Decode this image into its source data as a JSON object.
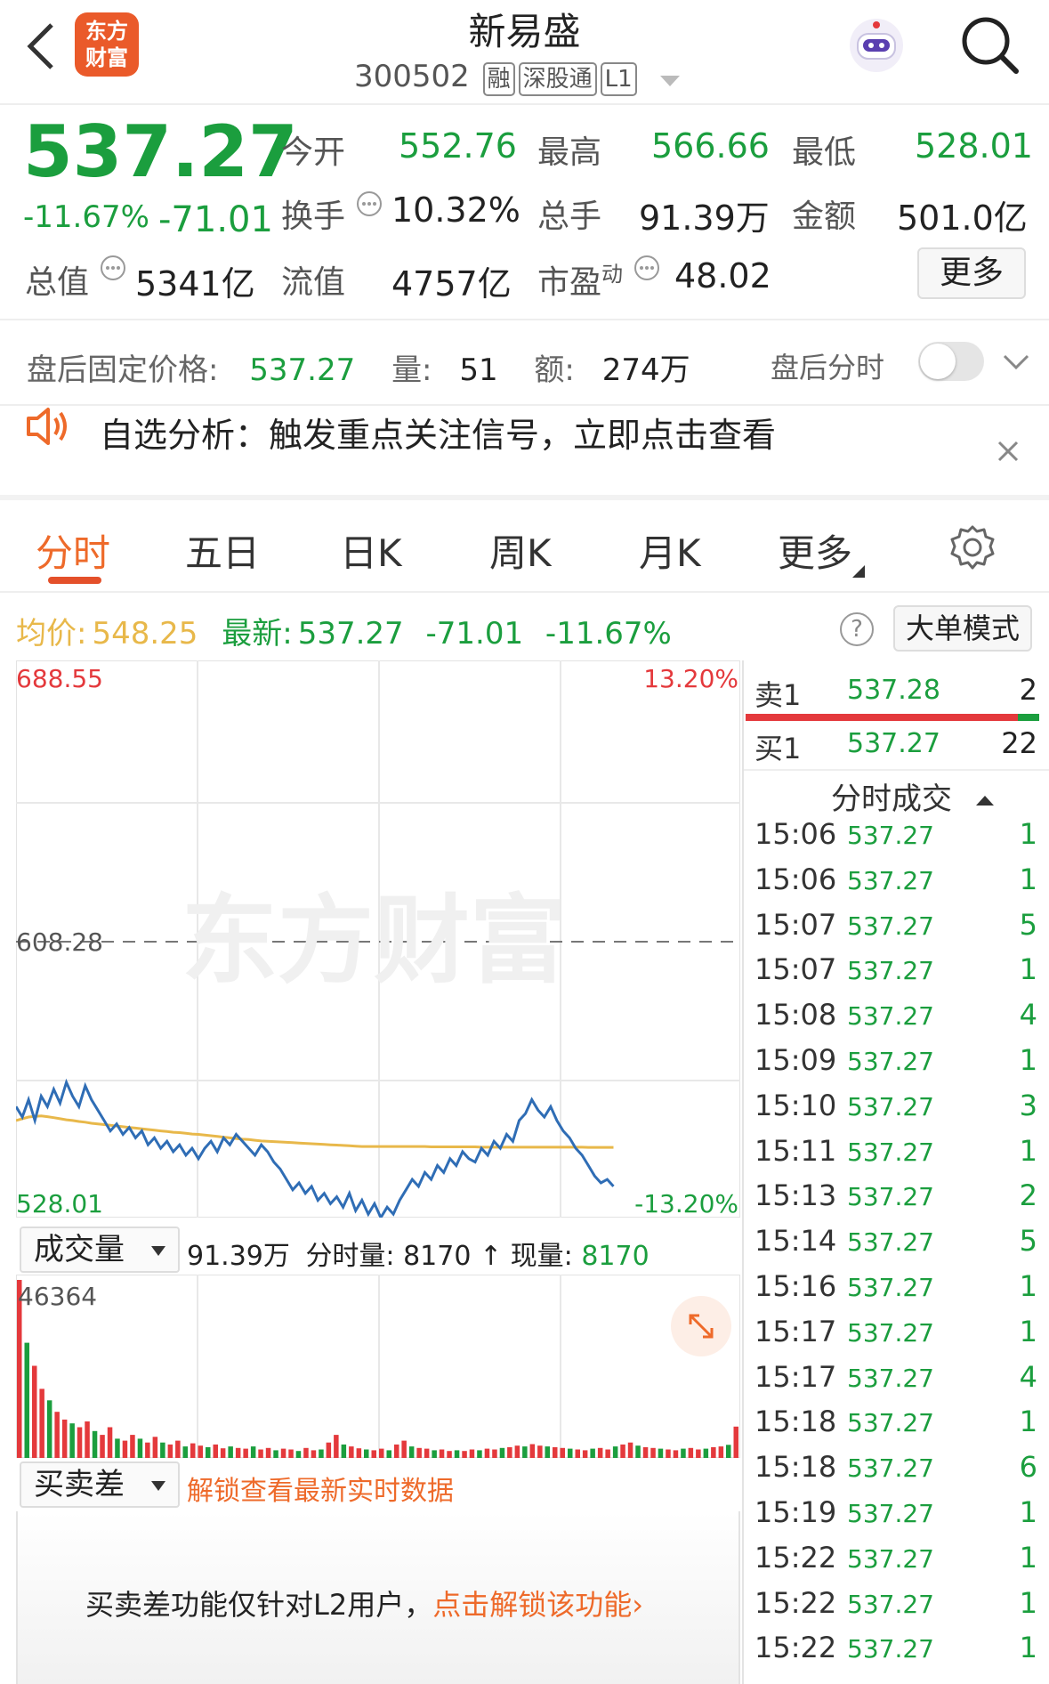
{
  "header": {
    "logo_text_1": "东方",
    "logo_text_2": "财富",
    "stock_name": "新易盛",
    "stock_code": "300502",
    "tags": [
      "融",
      "深股通",
      "L1"
    ]
  },
  "quote": {
    "price": "537.27",
    "change_pct": "-11.67%",
    "change_amt": "-71.01",
    "open_label": "今开",
    "open_value": "552.76",
    "high_label": "最高",
    "high_value": "566.66",
    "low_label": "最低",
    "low_value": "528.01",
    "turnover_label": "换手",
    "turnover_value": "10.32%",
    "volume_label": "总手",
    "volume_value": "91.39万",
    "amount_label": "金额",
    "amount_value": "501.0亿",
    "mktcap_label": "总值",
    "mktcap_value": "5341亿",
    "float_label": "流值",
    "float_value": "4757亿",
    "pe_label": "市盈",
    "pe_sup": "动",
    "pe_value": "48.02",
    "more_button": "更多"
  },
  "after_hours": {
    "label": "盘后固定价格:",
    "price": "537.27",
    "vol_label": "量:",
    "vol": "51",
    "amt_label": "额:",
    "amt": "274万",
    "toggle_label": "盘后分时"
  },
  "notice": {
    "text": "自选分析：触发重点关注信号，立即点击查看"
  },
  "tabs": [
    "分时",
    "五日",
    "日K",
    "周K",
    "月K",
    "更多"
  ],
  "info_bar": {
    "avg_label": "均价:",
    "avg_value": "548.25",
    "latest_label": "最新:",
    "latest_value": "537.27",
    "latest_change": "-71.01",
    "latest_pct": "-11.67%",
    "help": "?",
    "big_order_button": "大单模式"
  },
  "chart_data": {
    "type": "line",
    "y_top": "688.55",
    "y_mid": "608.28",
    "y_bottom": "528.01",
    "pct_top": "13.20%",
    "pct_bottom": "-13.20%",
    "ylim": [
      528.01,
      688.55
    ],
    "watermark": "东方财富",
    "series": [
      {
        "name": "价格",
        "values": [
          560,
          557,
          562,
          556,
          563,
          560,
          565,
          561,
          567,
          563,
          560,
          566,
          562,
          559,
          556,
          553,
          555,
          552,
          554,
          551,
          553,
          549,
          551,
          548,
          550,
          547,
          549,
          546,
          548,
          545,
          548,
          550,
          547,
          551,
          549,
          552,
          550,
          548,
          546,
          549,
          547,
          544,
          542,
          539,
          536,
          538,
          535,
          537,
          533,
          535,
          532,
          534,
          531,
          535,
          530,
          533,
          529,
          532,
          528,
          531,
          529,
          533,
          536,
          539,
          537,
          541,
          539,
          543,
          541,
          545,
          543,
          547,
          545,
          544,
          548,
          546,
          550,
          548,
          552,
          550,
          556,
          558,
          562,
          559,
          557,
          560,
          556,
          553,
          551,
          548,
          546,
          543,
          540,
          538,
          539,
          537
        ]
      },
      {
        "name": "均价",
        "values": [
          556,
          556.5,
          557,
          557.2,
          557.3,
          557.1,
          556.8,
          556.5,
          556.2,
          556,
          555.7,
          555.5,
          555.2,
          555,
          554.8,
          554.6,
          554.4,
          554.2,
          554,
          553.8,
          553.6,
          553.4,
          553.2,
          553,
          552.8,
          552.6,
          552.5,
          552.3,
          552.1,
          552,
          551.8,
          551.6,
          551.4,
          551.2,
          551,
          550.8,
          550.6,
          550.5,
          550.3,
          550.1,
          550,
          549.9,
          549.8,
          549.7,
          549.6,
          549.5,
          549.4,
          549.3,
          549.2,
          549.1,
          549,
          548.9,
          548.8,
          548.7,
          548.6,
          548.5,
          548.5,
          548.5,
          548.5,
          548.5,
          548.5,
          548.5,
          548.5,
          548.5,
          548.5,
          548.5,
          548.4,
          548.4,
          548.4,
          548.4,
          548.4,
          548.4,
          548.4,
          548.4,
          548.3,
          548.3,
          548.3,
          548.3,
          548.3,
          548.3,
          548.3,
          548.3,
          548.3,
          548.3,
          548.3,
          548.3,
          548.3,
          548.3,
          548.3,
          548.3,
          548.3,
          548.25,
          548.25,
          548.25,
          548.25,
          548.25
        ]
      }
    ],
    "volume": [
      46364,
      30000,
      24000,
      18000,
      15000,
      12000,
      10000,
      9000,
      8000,
      9500,
      7000,
      6000,
      8000,
      5000,
      4500,
      6000,
      5000,
      4000,
      5500,
      4000,
      3500,
      4500,
      3000,
      3800,
      3200,
      2800,
      3500,
      2500,
      3000,
      2600,
      2400,
      3000,
      2200,
      2600,
      2000,
      2400,
      2200,
      1800,
      2600,
      2000,
      2200,
      4000,
      6000,
      3500,
      3000,
      2500,
      2200,
      2000,
      2400,
      2000,
      3500,
      4500,
      3000,
      2600,
      2400,
      2000,
      2200,
      1800,
      2000,
      1800,
      2200,
      2000,
      2400,
      2200,
      2600,
      2800,
      3200,
      3000,
      3600,
      3200,
      3000,
      2800,
      2600,
      2400,
      2200,
      2000,
      2400,
      2600,
      2200,
      3000,
      3500,
      4000,
      3200,
      2800,
      2600,
      2400,
      2200,
      2000,
      2400,
      2600,
      2200,
      2400,
      2800,
      3000,
      3400,
      8170
    ]
  },
  "volume_section": {
    "dropdown": "成交量",
    "total": "91.39万",
    "tick_label": "分时量:",
    "tick_value": "8170",
    "arrow": "↑",
    "now_label": "现量:",
    "now_value": "8170",
    "max_label": "46364"
  },
  "spread_section": {
    "dropdown": "买卖差",
    "unlock_text": "解锁查看最新实时数据",
    "promo_text": "买卖差功能仅针对L2用户，",
    "promo_link": "点击解锁该功能"
  },
  "order_book": {
    "sell1_label": "卖1",
    "sell1_price": "537.28",
    "sell1_vol": "2",
    "buy1_label": "买1",
    "buy1_price": "537.27",
    "buy1_vol": "22"
  },
  "ticks_title": "分时成交",
  "ticks": [
    {
      "t": "15:06",
      "p": "537.27",
      "v": "1"
    },
    {
      "t": "15:06",
      "p": "537.27",
      "v": "1"
    },
    {
      "t": "15:07",
      "p": "537.27",
      "v": "5"
    },
    {
      "t": "15:07",
      "p": "537.27",
      "v": "1"
    },
    {
      "t": "15:08",
      "p": "537.27",
      "v": "4"
    },
    {
      "t": "15:09",
      "p": "537.27",
      "v": "1"
    },
    {
      "t": "15:10",
      "p": "537.27",
      "v": "3"
    },
    {
      "t": "15:11",
      "p": "537.27",
      "v": "1"
    },
    {
      "t": "15:13",
      "p": "537.27",
      "v": "2"
    },
    {
      "t": "15:14",
      "p": "537.27",
      "v": "5"
    },
    {
      "t": "15:16",
      "p": "537.27",
      "v": "1"
    },
    {
      "t": "15:17",
      "p": "537.27",
      "v": "1"
    },
    {
      "t": "15:17",
      "p": "537.27",
      "v": "4"
    },
    {
      "t": "15:18",
      "p": "537.27",
      "v": "1"
    },
    {
      "t": "15:18",
      "p": "537.27",
      "v": "6"
    },
    {
      "t": "15:19",
      "p": "537.27",
      "v": "1"
    },
    {
      "t": "15:22",
      "p": "537.27",
      "v": "1"
    },
    {
      "t": "15:22",
      "p": "537.27",
      "v": "1"
    },
    {
      "t": "15:22",
      "p": "537.27",
      "v": "1"
    }
  ],
  "colors": {
    "up": "#e4393c",
    "down": "#1b9e3e",
    "accent": "#ee6a2a",
    "avg_line": "#e8b84a",
    "price_line": "#2f6db5"
  }
}
